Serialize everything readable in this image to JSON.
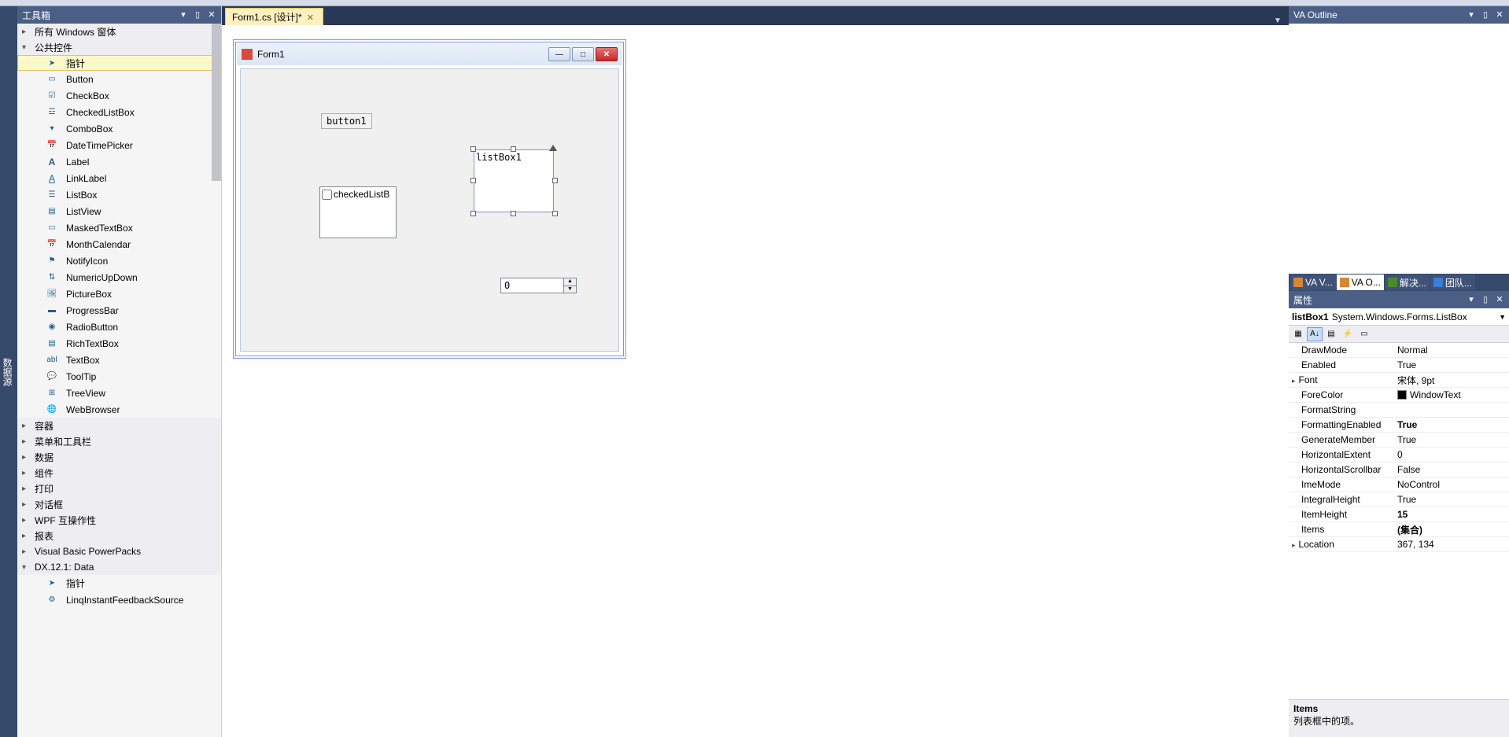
{
  "left_vtab": {
    "label": "数据源"
  },
  "toolbox": {
    "title": "工具箱",
    "categories": {
      "allForms": "所有 Windows 窗体",
      "common": "公共控件",
      "containers": "容器",
      "menus": "菜单和工具栏",
      "data": "数据",
      "components": "组件",
      "printing": "打印",
      "dialogs": "对话框",
      "wpf": "WPF 互操作性",
      "reports": "报表",
      "vbpp": "Visual Basic PowerPacks",
      "dxdata": "DX.12.1: Data"
    },
    "items": {
      "pointer": "指针",
      "button": "Button",
      "checkbox": "CheckBox",
      "checkedlistbox": "CheckedListBox",
      "combobox": "ComboBox",
      "datetimepicker": "DateTimePicker",
      "label": "Label",
      "linklabel": "LinkLabel",
      "listbox": "ListBox",
      "listview": "ListView",
      "maskedtextbox": "MaskedTextBox",
      "monthcalendar": "MonthCalendar",
      "notifyicon": "NotifyIcon",
      "numericupdown": "NumericUpDown",
      "picturebox": "PictureBox",
      "progressbar": "ProgressBar",
      "radiobutton": "RadioButton",
      "richtextbox": "RichTextBox",
      "textbox": "TextBox",
      "tooltip": "ToolTip",
      "treeview": "TreeView",
      "webbrowser": "WebBrowser",
      "pointer2": "指针",
      "linqfeed": "LinqInstantFeedbackSource"
    }
  },
  "doc": {
    "tab_label": "Form1.cs [设计]*",
    "form_title": "Form1",
    "button1": "button1",
    "checkedlist": "checkedListB",
    "listbox": "listBox1",
    "numeric_val": "0"
  },
  "va_outline": {
    "title": "VA Outline"
  },
  "right_tabs": {
    "va_view": "VA V...",
    "va_outline": "VA O...",
    "solution": "解决...",
    "team": "团队..."
  },
  "props": {
    "title": "属性",
    "selector": {
      "name": "listBox1",
      "type": "System.Windows.Forms.ListBox"
    },
    "rows": [
      {
        "k": "DrawMode",
        "v": "Normal"
      },
      {
        "k": "Enabled",
        "v": "True"
      },
      {
        "k": "Font",
        "v": "宋体, 9pt",
        "expandable": true
      },
      {
        "k": "ForeColor",
        "v": "WindowText",
        "swatch": "#000000"
      },
      {
        "k": "FormatString",
        "v": ""
      },
      {
        "k": "FormattingEnabled",
        "v": "True",
        "bold": true
      },
      {
        "k": "GenerateMember",
        "v": "True"
      },
      {
        "k": "HorizontalExtent",
        "v": "0"
      },
      {
        "k": "HorizontalScrollbar",
        "v": "False"
      },
      {
        "k": "ImeMode",
        "v": "NoControl"
      },
      {
        "k": "IntegralHeight",
        "v": "True"
      },
      {
        "k": "ItemHeight",
        "v": "15",
        "bold": true
      },
      {
        "k": "Items",
        "v": "(集合)",
        "bold": true
      },
      {
        "k": "Location",
        "v": "367, 134",
        "expandable": true
      }
    ],
    "desc": {
      "title": "Items",
      "text": "列表框中的项。"
    }
  }
}
